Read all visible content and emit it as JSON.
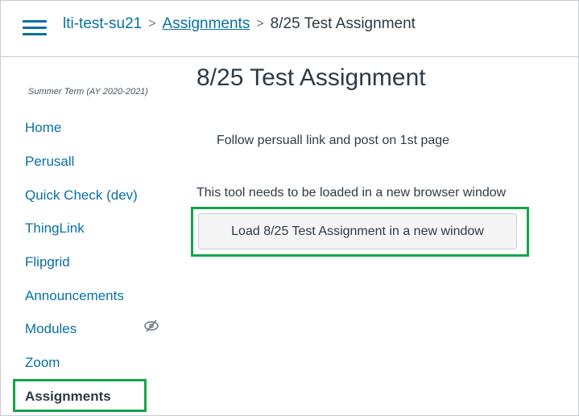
{
  "header": {
    "breadcrumb": {
      "course": "lti-test-su21",
      "section": "Assignments",
      "current": "8/25 Test Assignment",
      "separator": ">"
    }
  },
  "sidebar": {
    "term": "Summer Term (AY 2020-2021)",
    "items": [
      {
        "label": "Home"
      },
      {
        "label": "Perusall"
      },
      {
        "label": "Quick Check (dev)"
      },
      {
        "label": "ThingLink"
      },
      {
        "label": "Flipgrid"
      },
      {
        "label": "Announcements"
      },
      {
        "label": "Modules",
        "hidden_icon": "eye-slash-icon"
      },
      {
        "label": "Zoom"
      },
      {
        "label": "Assignments",
        "active": true
      }
    ]
  },
  "main": {
    "title": "8/25 Test Assignment",
    "description": "Follow persuall link and post on 1st page",
    "notice": "This tool needs to be loaded in a new browser window",
    "load_button": "Load 8/25 Test Assignment in a new window"
  },
  "colors": {
    "link": "#0770a3",
    "text": "#2d3b45",
    "highlight": "#13a54a",
    "border": "#c7cdd1"
  }
}
